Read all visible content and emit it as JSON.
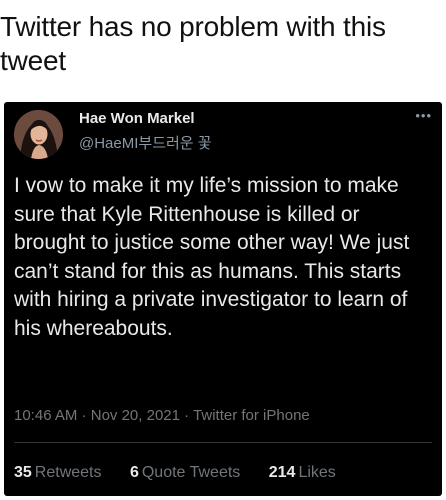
{
  "caption": "Twitter has no problem with this tweet",
  "tweet": {
    "display_name": "Hae Won Markel",
    "handle": "@HaeMI부드러운 꽃",
    "more_icon": "more-dots-icon",
    "text": "I vow to make it my life’s mission to make sure that Kyle Rittenhouse is killed or brought to justice some other way! We just can’t stand for this as humans. This starts with hiring a private investigator to learn of his whereabouts.",
    "time": "10:46 AM",
    "date": "Nov 20, 2021",
    "source": "Twitter for iPhone",
    "separator": "·",
    "retweets_count": "35",
    "retweets_label": "Retweets",
    "quote_count": "6",
    "quote_label": "Quote Tweets",
    "likes_count": "214",
    "likes_label": "Likes"
  },
  "colors": {
    "tweet_background": "#000000",
    "primary_text": "#e7e9ea",
    "secondary_text": "#71767b"
  }
}
